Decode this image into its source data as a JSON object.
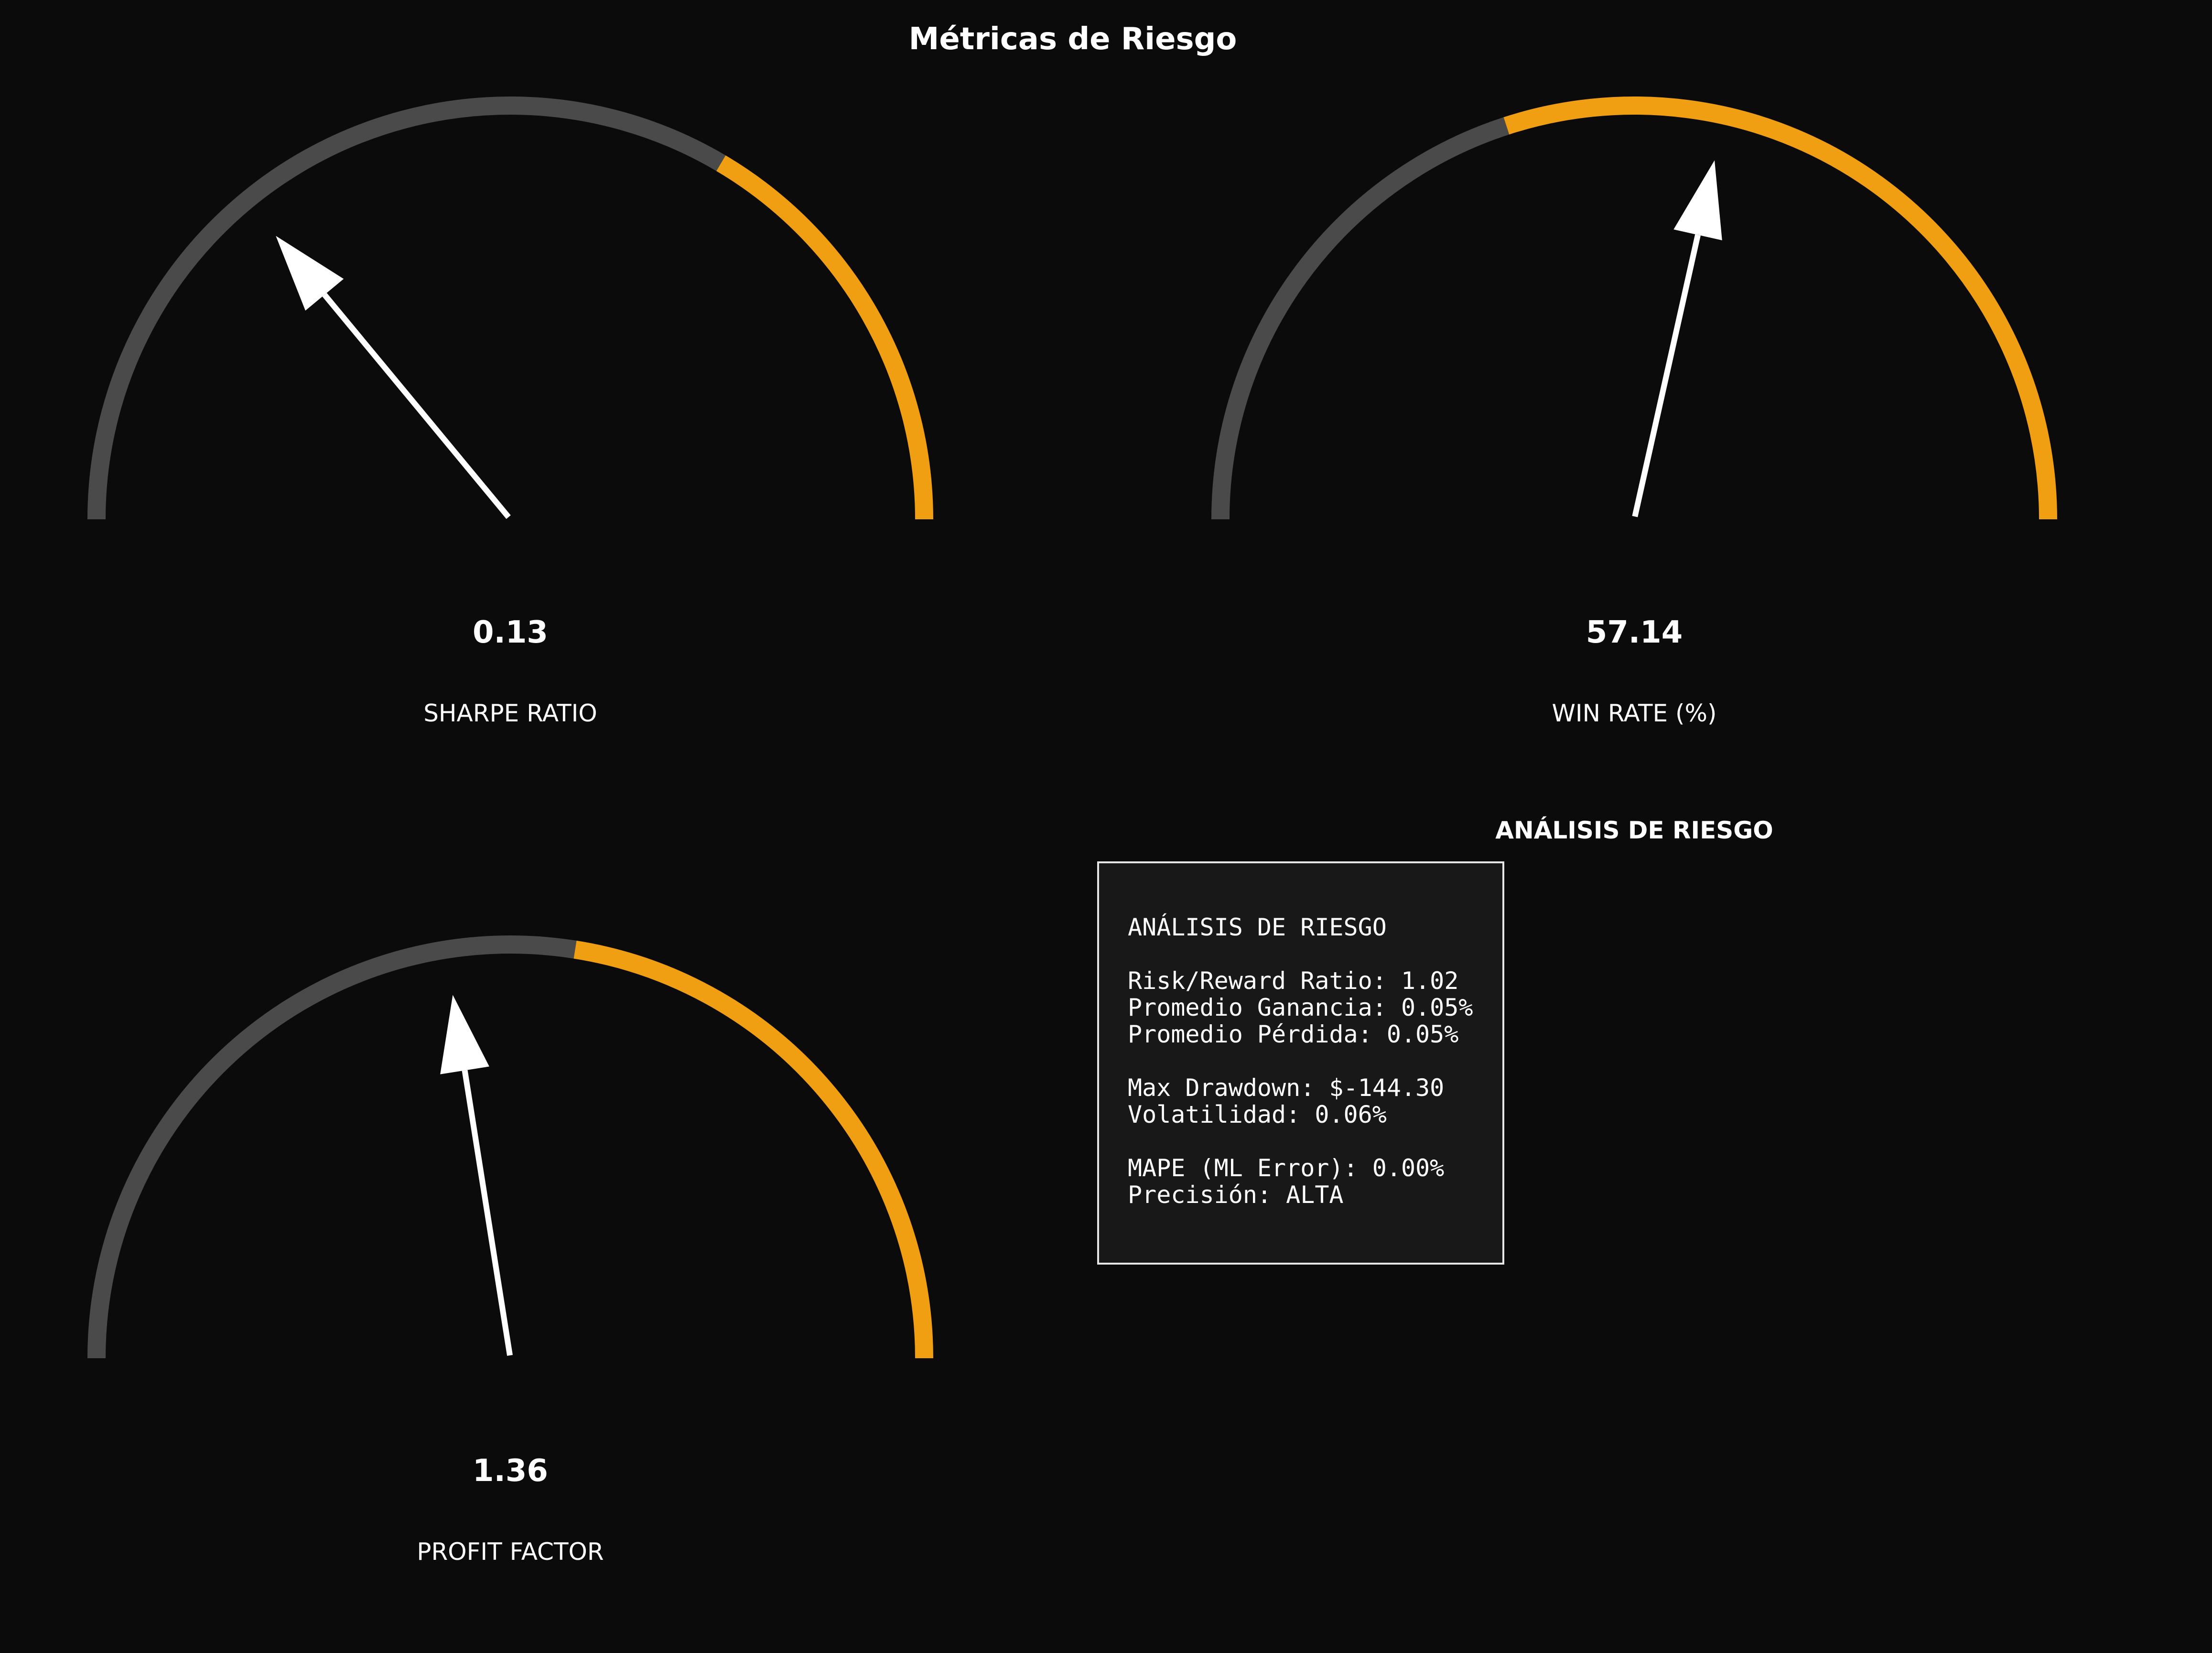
{
  "title": "Métricas de Riesgo",
  "colors": {
    "background": "#0b0b0b",
    "track": "#4a4a4a",
    "accent": "#f09e12",
    "needle": "#ffffff",
    "panel_bg": "#181818",
    "panel_border": "#e6e6e6",
    "text": "#ffffff"
  },
  "chart_data": [
    {
      "type": "gauge",
      "label": "SHARPE RATIO",
      "value_text": "0.13",
      "needle_fraction": 0.28,
      "threshold_fraction": 0.67
    },
    {
      "type": "gauge",
      "label": "WIN RATE (%)",
      "value_text": "57.14",
      "needle_fraction": 0.57,
      "threshold_fraction": 0.4
    },
    {
      "type": "gauge",
      "label": "PROFIT FACTOR",
      "value_text": "1.36",
      "needle_fraction": 0.45,
      "threshold_fraction": 0.55
    }
  ],
  "risk_panel": {
    "heading": "ANÁLISIS DE RIESGO",
    "title": "ANÁLISIS DE RIESGO",
    "lines": [
      "Risk/Reward Ratio: 1.02",
      "Promedio Ganancia: 0.05%",
      "Promedio Pérdida: 0.05%",
      "Max Drawdown: $-144.30",
      "Volatilidad: 0.06%",
      "MAPE (ML Error): 0.00%",
      "Precisión: ALTA"
    ]
  }
}
